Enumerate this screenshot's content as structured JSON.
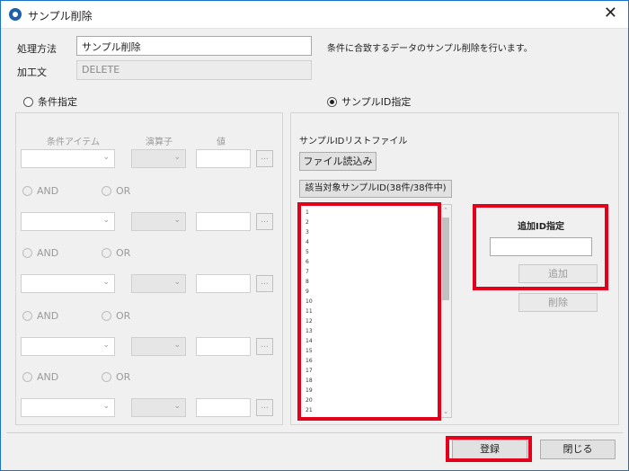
{
  "window": {
    "title": "サンプル削除",
    "close_glyph": "✕"
  },
  "form": {
    "process_method_label": "処理方法",
    "process_method_value": "サンプル削除",
    "description": "条件に合致するデータのサンプル削除を行います。",
    "processing_text_label": "加工文",
    "processing_text_value": "DELETE"
  },
  "mode": {
    "condition_option": "条件指定",
    "sample_id_option": "サンプルID指定",
    "selected": "sample_id"
  },
  "condition_panel": {
    "headers": {
      "item": "条件アイテム",
      "operator": "演算子",
      "value": "値"
    },
    "dots_label": "...",
    "and_label": "AND",
    "or_label": "OR",
    "row_count": 5
  },
  "sample_id_panel": {
    "list_file_label": "サンプルIDリストファイル",
    "load_file_button": "ファイル読込み",
    "target_count_button": "該当対象サンプルID(38件/38件中)",
    "ids": [
      "1",
      "2",
      "3",
      "4",
      "5",
      "6",
      "7",
      "8",
      "9",
      "10",
      "11",
      "12",
      "13",
      "14",
      "15",
      "16",
      "17",
      "18",
      "19",
      "20",
      "21"
    ],
    "add_id_label": "追加ID指定",
    "add_id_value": "",
    "add_button": "追加",
    "delete_button": "削除"
  },
  "footer": {
    "register_button": "登録",
    "close_button": "閉じる"
  },
  "colors": {
    "highlight": "#e4001b",
    "title_accent": "#1a73c9"
  },
  "icons": {
    "app": "app-logo-icon",
    "close": "close-icon",
    "dropdown": "chevron-down-icon"
  }
}
